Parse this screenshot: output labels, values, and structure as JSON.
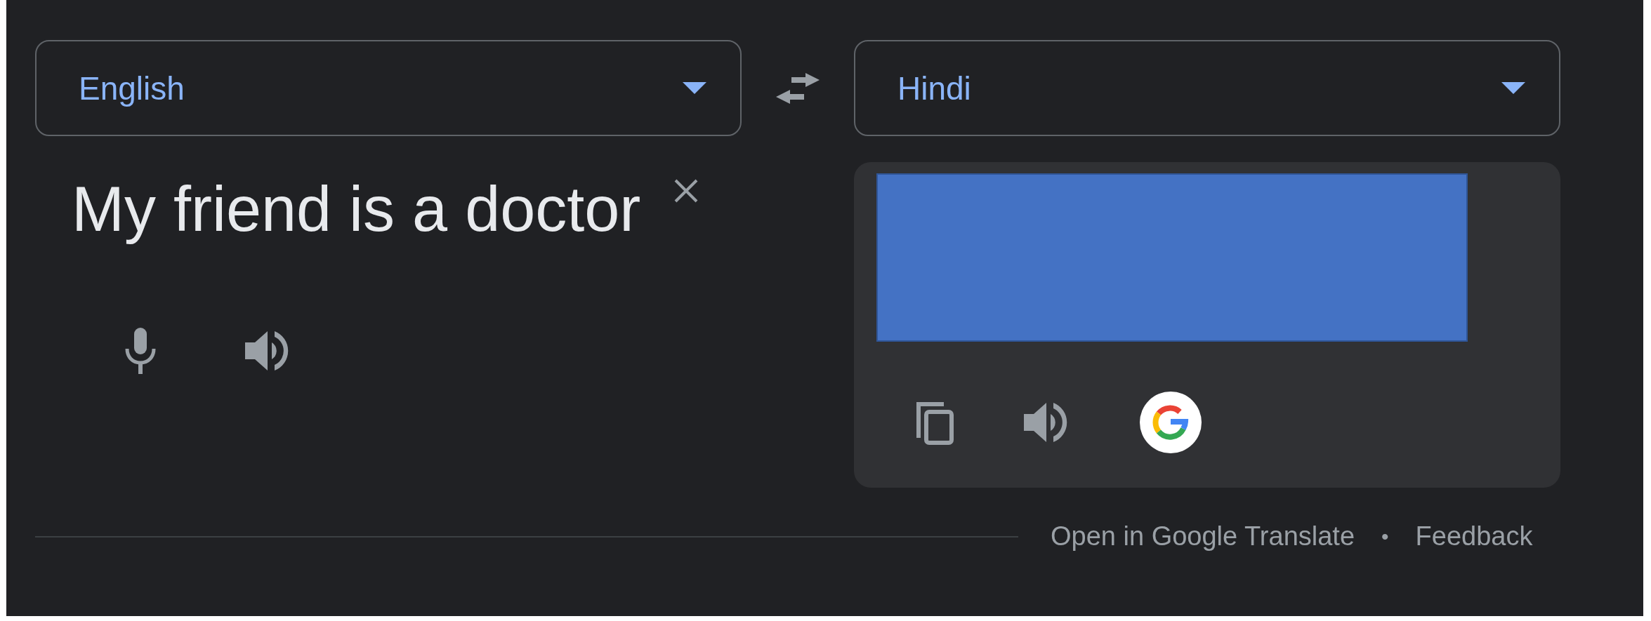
{
  "source_language": {
    "label": "English"
  },
  "target_language": {
    "label": "Hindi"
  },
  "source_text": "My friend is a doctor",
  "footer": {
    "links": [
      "Open in Google Translate",
      "Feedback"
    ],
    "separator": "•"
  }
}
